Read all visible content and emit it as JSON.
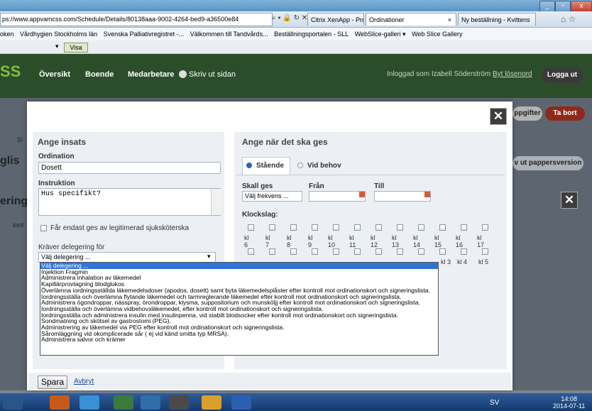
{
  "browser": {
    "url": "ps://www.appvamcss.com/Schedule/Details/80138aaa-9002-4264-bed9-a36500e84",
    "url_controls": "⌕ ▾ 🔒 ↻ ✕",
    "tabs": [
      "Citrix XenApp - Program",
      "Ordinationer",
      "Ny beställning - Kvittens"
    ],
    "tab_close": "×",
    "favorites": [
      "oken",
      "Vårdhygien Stockholms län",
      "Svenska Palliativregistret -...",
      "Välkommen till Tandvårds...",
      "Beställningsportalen - SLL",
      "WebSlice-galleri ▾",
      "Web Slice Gallery"
    ],
    "visa_label": "Visa",
    "visa_chevron": "▾",
    "window_buttons": [
      "_",
      "▫",
      "x"
    ],
    "corner_icons": "⌂ ☆"
  },
  "site": {
    "logo": "SS",
    "nav": [
      "Översikt",
      "Boende",
      "Medarbetare"
    ],
    "print": "Skriv ut sidan",
    "logged_in_prefix": "Inloggad som Izabell Söderström",
    "change_password": "Byt lösenord",
    "logout": "Logga ut",
    "bg_buttons": [
      "ppgifter",
      "Ta bort"
    ],
    "bg_paper": "v ut pappersversion",
    "bg_text1": "glis",
    "bg_text2": "ering",
    "bg_text3": "Si",
    "bg_text4": "lord"
  },
  "modal": {
    "left_header": "Ange insats",
    "ordination_label": "Ordination",
    "ordination_value": "Dosett",
    "instruktion_label": "Instruktion",
    "instruktion_value": "Hus specifikt?",
    "nurse_only_label": "Får endast ges av legitimerad sjuksköterska",
    "delegation_label": "Kräver delegering för",
    "delegation_value": "Välj delegering ...",
    "right_header": "Ange när det ska ges",
    "stående": "Stående",
    "vid_behov": "Vid behov",
    "skall_ges": "Skall ges",
    "frekvens": "Välj frekvens ...",
    "fran": "Från",
    "till": "Till",
    "klockslag": "Klockslag:",
    "clock_row1": [
      "kl 6",
      "kl 7",
      "kl 8",
      "kl 9",
      "kl 10",
      "kl 11",
      "kl 12",
      "kl 13",
      "kl 14",
      "kl 15",
      "kl 16",
      "kl 17"
    ],
    "clock_row2_visible": [
      "kl 3",
      "kl 4",
      "kl 5"
    ],
    "close": "✕",
    "save": "Spara",
    "cancel": "Avbryt"
  },
  "dropdown_options": [
    "Välj delegering ...",
    "Injektion Fragmin",
    "Administrera inhalation av läkemedel",
    "Kapillärprovtagning blodglukos",
    "Överlämna iordningsställda läkemedelsdoser (apodos, dosett) samt byta läkemedelsplåster efter kontroll mot ordinationskort och signeringslista.",
    "Iordningsställa och överlämna flytande läkemedel och tarmreglerande läkemedel efter kontroll mot ordinationskort och signeringslista.",
    "Administrera ögondroppar, nässpray, örondroppar, klysma, suppositorium och munsköljj efter kontroll mot ordinationskort och signeringslista.",
    "Iordningsställa och överlämna vidbehovsläkemedel, efter kontroll mot ordinationskort och signeringslista.",
    "Iordningsställa och administrera insulin med insulinpenna, vid stabilt blodsocker efter kontroll mot ordinationskort och signeringslista.",
    "Sondmatning och skötsel av gastrostomi (PEG).",
    "Administrering av läkemedel via PEG efter kontroll mot ordinationskort och signeringslista.",
    "Såromläggning vid okomplicerade sår ( ej vid känd smitta typ MRSA).",
    "Administrera salvor och krämer"
  ],
  "taskbar": {
    "lang": "SV",
    "time": "14:08",
    "date": "2014-07-11"
  }
}
